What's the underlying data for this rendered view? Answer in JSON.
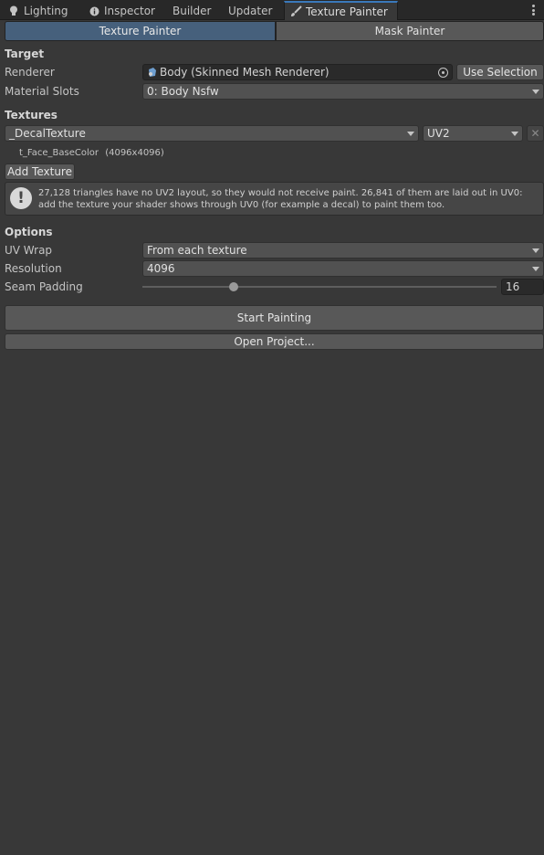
{
  "tabs": [
    {
      "label": "Lighting",
      "icon": "lightbulb-icon"
    },
    {
      "label": "Inspector",
      "icon": "info-icon"
    },
    {
      "label": "Builder"
    },
    {
      "label": "Updater"
    },
    {
      "label": "Texture Painter",
      "icon": "brush-icon",
      "active": true
    }
  ],
  "toolbar": {
    "texture_painter": "Texture Painter",
    "mask_painter": "Mask Painter"
  },
  "target": {
    "section": "Target",
    "renderer_label": "Renderer",
    "renderer_value": "Body (Skinned Mesh Renderer)",
    "use_selection": "Use Selection",
    "material_slots_label": "Material Slots",
    "material_slots_value": "0: Body Nsfw"
  },
  "textures": {
    "section": "Textures",
    "property": "_DecalTexture",
    "uv": "UV2",
    "texture_name": "t_Face_BaseColor",
    "texture_size": "(4096x4096)",
    "add_texture": "Add Texture",
    "warning": "27,128 triangles have no UV2 layout, so they would not receive paint. 26,841 of them are laid out in UV0: add the texture your shader shows through UV0 (for example a decal) to paint them too."
  },
  "options": {
    "section": "Options",
    "uv_wrap_label": "UV Wrap",
    "uv_wrap_value": "From each texture",
    "resolution_label": "Resolution",
    "resolution_value": "4096",
    "seam_padding_label": "Seam Padding",
    "seam_padding_value": "16",
    "seam_padding_fraction": 0.25
  },
  "actions": {
    "start_painting": "Start Painting",
    "open_project": "Open Project..."
  },
  "colors": {
    "background": "#383838",
    "tab_accent": "#3a79bb",
    "toggle_active": "#46607c"
  }
}
